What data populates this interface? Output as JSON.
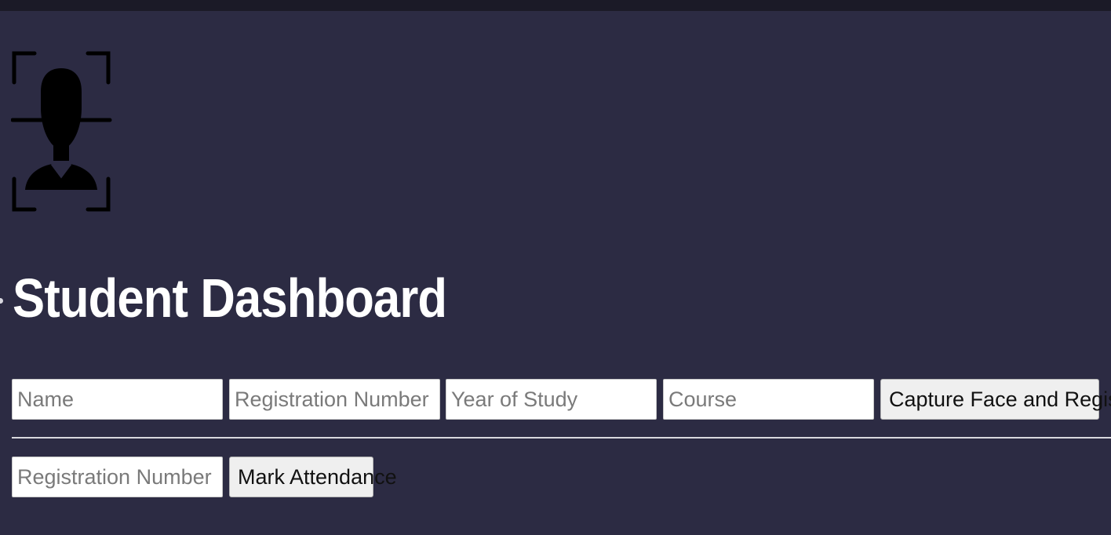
{
  "header": {
    "logo_icon": "face-recognition-icon"
  },
  "page": {
    "title": "Student Dashboard"
  },
  "register_form": {
    "name": {
      "placeholder": "Name",
      "value": ""
    },
    "registration_number": {
      "placeholder": "Registration Number",
      "value": ""
    },
    "year_of_study": {
      "placeholder": "Year of Study",
      "value": ""
    },
    "course": {
      "placeholder": "Course",
      "value": ""
    },
    "submit_label": "Capture Face and Register"
  },
  "attendance_form": {
    "registration_number": {
      "placeholder": "Registration Number",
      "value": ""
    },
    "submit_label": "Mark Attendance"
  },
  "colors": {
    "background": "#2c2b43",
    "title": "#ffffff",
    "button": "#efefef"
  }
}
